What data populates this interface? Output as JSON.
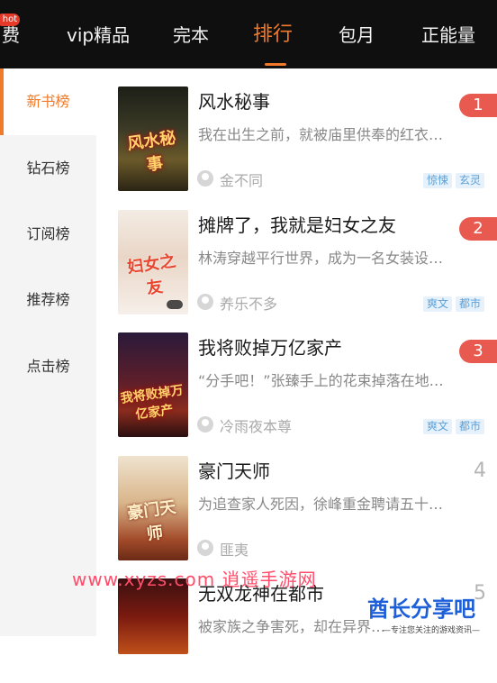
{
  "nav": {
    "tabs": [
      {
        "label": "费"
      },
      {
        "label": "vip精品"
      },
      {
        "label": "完本"
      },
      {
        "label": "排行"
      },
      {
        "label": "包月"
      },
      {
        "label": "正能量"
      }
    ],
    "hot_badge": "hot",
    "active_tab": "排行",
    "active_color": "#f07a2a"
  },
  "sidebar": {
    "items": [
      {
        "label": "新书榜"
      },
      {
        "label": "钻石榜"
      },
      {
        "label": "订阅榜"
      },
      {
        "label": "推荐榜"
      },
      {
        "label": "点击榜"
      }
    ]
  },
  "books": [
    {
      "rank": "1",
      "title": "风水秘事",
      "desc": "我在出生之前，就被庙里供奉的红衣…",
      "author": "金不同",
      "tags": [
        "惊悚",
        "玄灵"
      ],
      "cover_text": "风水秘事"
    },
    {
      "rank": "2",
      "title": "摊牌了，我就是妇女之友",
      "desc": "林涛穿越平行世界，成为一名女装设…",
      "author": "养乐不多",
      "tags": [
        "爽文",
        "都市"
      ],
      "cover_text": "妇女之友"
    },
    {
      "rank": "3",
      "title": "我将败掉万亿家产",
      "desc": "“分手吧！”张臻手上的花束掉落在地…",
      "author": "冷雨夜本尊",
      "tags": [
        "爽文",
        "都市"
      ],
      "cover_text": "我将败掉万亿家产"
    },
    {
      "rank": "4",
      "title": "豪门天师",
      "desc": "为追查家人死因，徐峰重金聘请五十…",
      "author": "匪夷",
      "tags": [],
      "cover_text": "豪门天师"
    },
    {
      "rank": "5",
      "title": "无双龙神在都市",
      "desc": "被家族之争害死，却在异界…",
      "author": "",
      "tags": [],
      "cover_text": ""
    }
  ],
  "watermark": {
    "text": "www.xyzs.com 逍遥手游网",
    "brand": "酋长分享吧",
    "sub": "—专注您关注的游戏资讯—"
  }
}
